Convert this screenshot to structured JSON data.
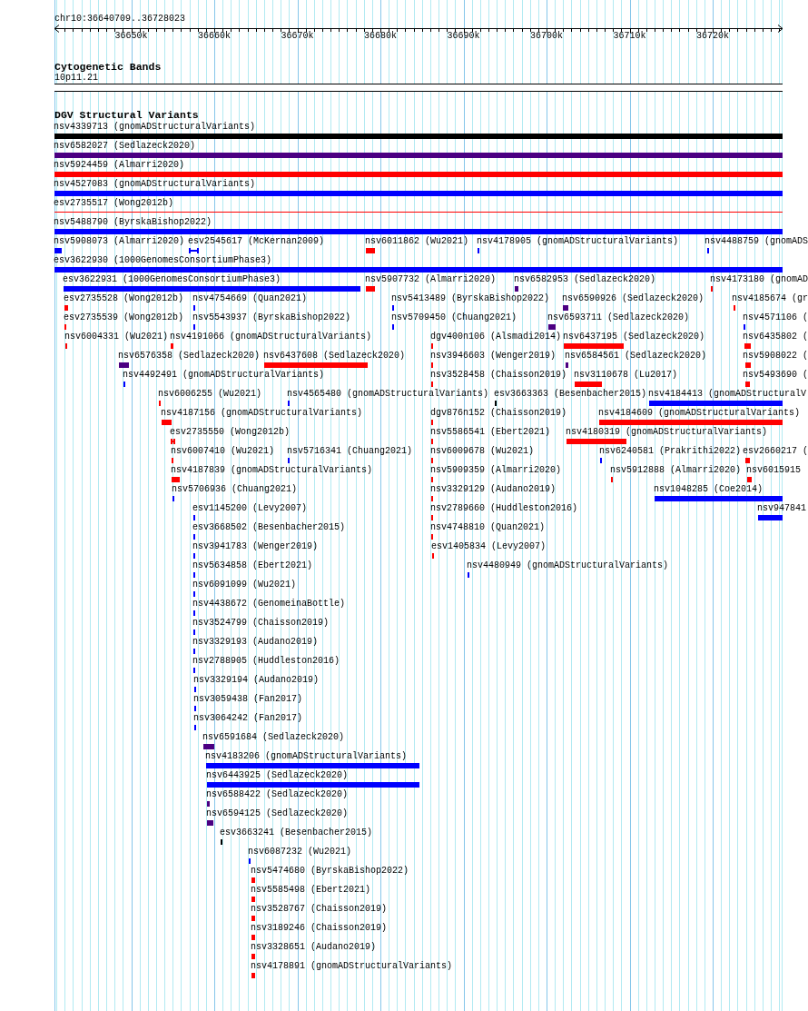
{
  "ruler": {
    "location": "chr10:36640709..36728023",
    "tick_labels": [
      "36650k",
      "36660k",
      "36670k",
      "36680k",
      "36690k",
      "36700k",
      "36710k",
      "36720k"
    ]
  },
  "cytoband_track": {
    "title": "Cytogenetic Bands",
    "band": "10p11.21"
  },
  "variant_track": {
    "title": "DGV Structural Variants",
    "features": [
      {
        "label": "nsv4339713 (gnomADStructuralVariants)",
        "kind": "block",
        "color": "#000000"
      },
      {
        "label": "nsv6582027 (Sedlazeck2020)",
        "kind": "block",
        "color": "#4b0082"
      },
      {
        "label": "nsv5924459 (Almarri2020)",
        "kind": "block",
        "color": "#ff0000"
      },
      {
        "label": "nsv4527083 (gnomADStructuralVariants)",
        "kind": "block",
        "color": "#0000ff"
      },
      {
        "label": "esv2735517 (Wong2012b)",
        "kind": "line",
        "color": "#ff0000"
      },
      {
        "label": "nsv5488790 (ByrskaBishop2022)",
        "kind": "block",
        "color": "#0000ff"
      },
      {
        "label": "nsv5908073 (Almarri2020)",
        "kind": "block",
        "color": "#0000ff"
      },
      {
        "label": "esv2545617 (McKernan2009)",
        "kind": "segmented",
        "color": "#0000ff"
      },
      {
        "label": "nsv6011862 (Wu2021)",
        "kind": "block",
        "color": "#ff0000"
      },
      {
        "label": "nsv4178905 (gnomADStructuralVariants)",
        "kind": "block",
        "color": "#0000ff"
      },
      {
        "label": "nsv4488759 (gnomADS",
        "kind": "block",
        "color": "#0000ff"
      },
      {
        "label": "esv3622930 (1000GenomesConsortiumPhase3)",
        "kind": "block",
        "color": "#0000ff"
      },
      {
        "label": "esv3622931 (1000GenomesConsortiumPhase3)",
        "kind": "block",
        "color": "#0000ff"
      },
      {
        "label": "nsv5907732 (Almarri2020)",
        "kind": "block",
        "color": "#ff0000"
      },
      {
        "label": "nsv6582953 (Sedlazeck2020)",
        "kind": "block",
        "color": "#4b0082"
      },
      {
        "label": "nsv4173180 (gnomAD",
        "kind": "block",
        "color": "#ff0000"
      },
      {
        "label": "esv2735528 (Wong2012b)",
        "kind": "block",
        "color": "#ff0000"
      },
      {
        "label": "nsv4754669 (Quan2021)",
        "kind": "block",
        "color": "#0000ff"
      },
      {
        "label": "nsv5413489 (ByrskaBishop2022)",
        "kind": "block",
        "color": "#0000ff"
      },
      {
        "label": "nsv6590926 (Sedlazeck2020)",
        "kind": "block",
        "color": "#4b0082"
      },
      {
        "label": "nsv4185674 (gr",
        "kind": "block",
        "color": "#ff0000"
      },
      {
        "label": "esv2735539 (Wong2012b)",
        "kind": "block",
        "color": "#ff0000"
      },
      {
        "label": "nsv5543937 (ByrskaBishop2022)",
        "kind": "block",
        "color": "#0000ff"
      },
      {
        "label": "nsv5709450 (Chuang2021)",
        "kind": "block",
        "color": "#0000ff"
      },
      {
        "label": "nsv6593711 (Sedlazeck2020)",
        "kind": "block",
        "color": "#4b0082"
      },
      {
        "label": "nsv4571106 (",
        "kind": "block",
        "color": "#0000ff"
      },
      {
        "label": "nsv6004331 (Wu2021)",
        "kind": "block",
        "color": "#ff0000"
      },
      {
        "label": "nsv4191066 (gnomADStructuralVariants)",
        "kind": "block",
        "color": "#ff0000"
      },
      {
        "label": "dgv400n106 (Alsmadi2014)",
        "kind": "block",
        "color": "#ff0000"
      },
      {
        "label": "nsv6437195 (Sedlazeck2020)",
        "kind": "block",
        "color": "#ff0000"
      },
      {
        "label": "nsv6435802 (",
        "kind": "block",
        "color": "#ff0000"
      },
      {
        "label": "nsv6576358 (Sedlazeck2020)",
        "kind": "block",
        "color": "#4b0082"
      },
      {
        "label": "nsv6437608 (Sedlazeck2020)",
        "kind": "block",
        "color": "#ff0000"
      },
      {
        "label": "nsv3946603 (Wenger2019)",
        "kind": "block",
        "color": "#ff0000"
      },
      {
        "label": "nsv6584561 (Sedlazeck2020)",
        "kind": "block",
        "color": "#4b0082"
      },
      {
        "label": "nsv5908022 (",
        "kind": "block",
        "color": "#ff0000"
      },
      {
        "label": "nsv4492491 (gnomADStructuralVariants)",
        "kind": "block",
        "color": "#0000ff"
      },
      {
        "label": "nsv3528458 (Chaisson2019)",
        "kind": "block",
        "color": "#ff0000"
      },
      {
        "label": "nsv3110678 (Lu2017)",
        "kind": "block",
        "color": "#ff0000"
      },
      {
        "label": "nsv5493690 (",
        "kind": "block",
        "color": "#ff0000"
      },
      {
        "label": "nsv6006255 (Wu2021)",
        "kind": "block",
        "color": "#ff0000"
      },
      {
        "label": "nsv4565480 (gnomADStructuralVariants)",
        "kind": "block",
        "color": "#0000ff"
      },
      {
        "label": "esv3663363 (Besenbacher2015)",
        "kind": "block",
        "color": "#000000"
      },
      {
        "label": "nsv4184413 (gnomADStructuralV",
        "kind": "block",
        "color": "#0000ff"
      },
      {
        "label": "nsv4187156 (gnomADStructuralVariants)",
        "kind": "block",
        "color": "#ff0000"
      },
      {
        "label": "dgv876n152 (Chaisson2019)",
        "kind": "block",
        "color": "#ff0000"
      },
      {
        "label": "nsv4184609 (gnomADStructuralVariants)",
        "kind": "block",
        "color": "#ff0000"
      },
      {
        "label": "esv2735550 (Wong2012b)",
        "kind": "segmented",
        "color": "#ff0000"
      },
      {
        "label": "nsv5586541 (Ebert2021)",
        "kind": "block",
        "color": "#ff0000"
      },
      {
        "label": "nsv4180319 (gnomADStructuralVariants)",
        "kind": "block",
        "color": "#ff0000"
      },
      {
        "label": "nsv6007410 (Wu2021)",
        "kind": "block",
        "color": "#ff0000"
      },
      {
        "label": "nsv5716341 (Chuang2021)",
        "kind": "block",
        "color": "#0000ff"
      },
      {
        "label": "nsv6009678 (Wu2021)",
        "kind": "block",
        "color": "#ff0000"
      },
      {
        "label": "nsv6240581 (Prakrithi2022)",
        "kind": "block",
        "color": "#0000ff"
      },
      {
        "label": "esv2660217 (",
        "kind": "block",
        "color": "#ff0000"
      },
      {
        "label": "nsv4187839 (gnomADStructuralVariants)",
        "kind": "block",
        "color": "#ff0000"
      },
      {
        "label": "nsv5909359 (Almarri2020)",
        "kind": "block",
        "color": "#ff0000"
      },
      {
        "label": "nsv5912888 (Almarri2020)",
        "kind": "block",
        "color": "#ff0000"
      },
      {
        "label": "nsv6015915",
        "kind": "block",
        "color": "#ff0000"
      },
      {
        "label": "nsv5706936 (Chuang2021)",
        "kind": "block",
        "color": "#0000ff"
      },
      {
        "label": "nsv3329129 (Audano2019)",
        "kind": "block",
        "color": "#ff0000"
      },
      {
        "label": "nsv1048285 (Coe2014)",
        "kind": "block",
        "color": "#0000ff"
      },
      {
        "label": "esv1145200 (Levy2007)",
        "kind": "block",
        "color": "#0000ff"
      },
      {
        "label": "nsv2789660 (Huddleston2016)",
        "kind": "block",
        "color": "#ff0000"
      },
      {
        "label": "nsv947841",
        "kind": "block",
        "color": "#0000ff"
      },
      {
        "label": "esv3668502 (Besenbacher2015)",
        "kind": "block",
        "color": "#0000ff"
      },
      {
        "label": "nsv4748810 (Quan2021)",
        "kind": "block",
        "color": "#ff0000"
      },
      {
        "label": "nsv3941783 (Wenger2019)",
        "kind": "block",
        "color": "#0000ff"
      },
      {
        "label": "esv1405834 (Levy2007)",
        "kind": "block",
        "color": "#ff0000"
      },
      {
        "label": "nsv5634858 (Ebert2021)",
        "kind": "block",
        "color": "#0000ff"
      },
      {
        "label": "nsv4480949 (gnomADStructuralVariants)",
        "kind": "block",
        "color": "#0000ff"
      },
      {
        "label": "nsv6091099 (Wu2021)",
        "kind": "block",
        "color": "#0000ff"
      },
      {
        "label": "nsv4438672 (GenomeinaBottle)",
        "kind": "block",
        "color": "#0000ff"
      },
      {
        "label": "nsv3524799 (Chaisson2019)",
        "kind": "block",
        "color": "#0000ff"
      },
      {
        "label": "nsv3329193 (Audano2019)",
        "kind": "block",
        "color": "#0000ff"
      },
      {
        "label": "nsv2788905 (Huddleston2016)",
        "kind": "block",
        "color": "#0000ff"
      },
      {
        "label": "nsv3329194 (Audano2019)",
        "kind": "block",
        "color": "#0000ff"
      },
      {
        "label": "nsv3059438 (Fan2017)",
        "kind": "block",
        "color": "#0000ff"
      },
      {
        "label": "nsv3064242 (Fan2017)",
        "kind": "block",
        "color": "#0000ff"
      },
      {
        "label": "nsv6591684 (Sedlazeck2020)",
        "kind": "block",
        "color": "#4b0082"
      },
      {
        "label": "nsv4183206 (gnomADStructuralVariants)",
        "kind": "block",
        "color": "#0000ff"
      },
      {
        "label": "nsv6443925 (Sedlazeck2020)",
        "kind": "block",
        "color": "#0000ff"
      },
      {
        "label": "nsv6588422 (Sedlazeck2020)",
        "kind": "block",
        "color": "#4b0082"
      },
      {
        "label": "nsv6594125 (Sedlazeck2020)",
        "kind": "block",
        "color": "#4b0082"
      },
      {
        "label": "esv3663241 (Besenbacher2015)",
        "kind": "block",
        "color": "#000000"
      },
      {
        "label": "nsv6087232 (Wu2021)",
        "kind": "block",
        "color": "#0000ff"
      },
      {
        "label": "nsv5474680 (ByrskaBishop2022)",
        "kind": "block",
        "color": "#ff0000"
      },
      {
        "label": "nsv5585498 (Ebert2021)",
        "kind": "block",
        "color": "#ff0000"
      },
      {
        "label": "nsv3528767 (Chaisson2019)",
        "kind": "block",
        "color": "#ff0000"
      },
      {
        "label": "nsv3189246 (Chaisson2019)",
        "kind": "block",
        "color": "#ff0000"
      },
      {
        "label": "nsv3328651 (Audano2019)",
        "kind": "block",
        "color": "#ff0000"
      },
      {
        "label": "nsv4178891 (gnomADStructuralVariants)",
        "kind": "block",
        "color": "#ff0000"
      }
    ]
  }
}
